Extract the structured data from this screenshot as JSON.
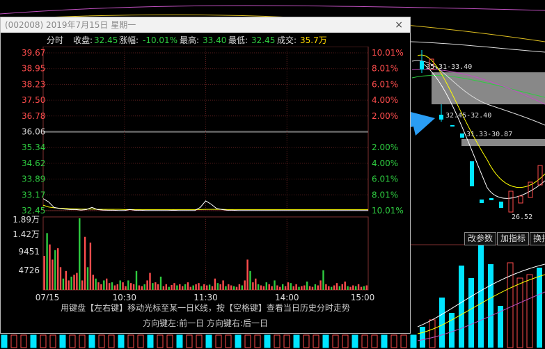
{
  "dialog": {
    "title": "(002008) 2019年7月15日 星期一",
    "close_label": "×",
    "info": {
      "mode_label": "分时",
      "close_label": "收盘:",
      "close_value": "32.45",
      "change_label": "涨幅:",
      "change_value": "-10.01%",
      "high_label": "最高:",
      "high_value": "33.40",
      "low_label": "最低:",
      "low_value": "32.45",
      "volume_label": "成交:",
      "volume_value": "35.7万"
    },
    "hint_line1": "用键盘【左右键】移动光标至某一日K线，按【空格键】查看当日历史分时走势",
    "hint_line2": "方向键左:前一日    方向键右:后一日"
  },
  "chart_data": {
    "type": "line",
    "y_left_ticks": [
      "39.67",
      "38.95",
      "38.23",
      "37.50",
      "36.78",
      "36.06",
      "35.34",
      "34.62",
      "33.89",
      "33.17",
      "32.45"
    ],
    "y_right_ticks": [
      "10.01%",
      "8.01%",
      "6.01%",
      "4.00%",
      "2.00%",
      "",
      "2.00%",
      "4.00%",
      "6.01%",
      "8.01%",
      "10.01%"
    ],
    "ylim": [
      32.45,
      39.67
    ],
    "prev_close": 36.06,
    "volume_ticks": [
      "1.89万",
      "1.42万",
      "9451",
      "4726"
    ],
    "volume_max": 18900,
    "x_ticks": [
      "07/15",
      "10:30",
      "11:30",
      "14:00",
      "15:00"
    ],
    "price_series": [
      33.0,
      32.85,
      32.6,
      32.55,
      32.52,
      32.5,
      32.5,
      32.48,
      32.5,
      32.6,
      32.5,
      32.48,
      32.47,
      32.47,
      32.46,
      32.46,
      32.5,
      32.47,
      32.47,
      32.46,
      32.46,
      32.46,
      32.46,
      32.46,
      32.47,
      32.46,
      32.46,
      32.46,
      32.46,
      32.6,
      32.9,
      32.75,
      32.55,
      32.5,
      32.47,
      32.47,
      32.46,
      32.46,
      32.46,
      32.46,
      32.46,
      32.46,
      32.46,
      32.46,
      32.46,
      32.46,
      32.46,
      32.46,
      32.46,
      32.46,
      32.46,
      32.46,
      32.46,
      32.46,
      32.46,
      32.46,
      32.46,
      32.46,
      32.46,
      32.46,
      32.46
    ],
    "avg_series": [
      32.7,
      32.62,
      32.58,
      32.56,
      32.55,
      32.54,
      32.53,
      32.52,
      32.52,
      32.52,
      32.51,
      32.51,
      32.51,
      32.51,
      32.51,
      32.5,
      32.5,
      32.5,
      32.5,
      32.5,
      32.5,
      32.5,
      32.5,
      32.5,
      32.5,
      32.5,
      32.5,
      32.5,
      32.5,
      32.5,
      32.51,
      32.51,
      32.51,
      32.51,
      32.5,
      32.5,
      32.5,
      32.5,
      32.5,
      32.5,
      32.5,
      32.5,
      32.5,
      32.5,
      32.5,
      32.5,
      32.5,
      32.5,
      32.5,
      32.5,
      32.5,
      32.5,
      32.5,
      32.5,
      32.5,
      32.5,
      32.5,
      32.5,
      32.5,
      32.5,
      32.5
    ],
    "volume_bars": [
      9000,
      15000,
      12000,
      8000,
      10500,
      11000,
      6000,
      3000,
      5000,
      2500,
      3500,
      4000,
      4500,
      18900,
      2500,
      14000,
      6000,
      12500,
      4000,
      3000,
      2000,
      1500,
      2500,
      3000,
      1800,
      2000,
      1200,
      1500,
      2500,
      2000,
      1000,
      2500,
      1800,
      1500,
      5000,
      1200,
      1000,
      1500,
      2500,
      4500,
      1800,
      2000,
      1500,
      3500,
      1000,
      1500,
      800,
      1300,
      1800,
      1200,
      1500,
      1000,
      1500,
      2000,
      800,
      1200,
      1500,
      1800,
      1000,
      1500,
      1200,
      1400,
      1000,
      3000,
      1800,
      1500,
      2500,
      1000,
      1500,
      1200,
      1000,
      800,
      1500,
      1200,
      2500,
      8000,
      5000,
      2000,
      3000,
      1500,
      1200,
      1000,
      2000,
      1500,
      1000,
      2500,
      1200,
      800,
      1500,
      1000,
      2000,
      1800,
      1000,
      1500,
      800,
      1000,
      1200,
      2200,
      1000,
      800,
      1500,
      1200,
      2500,
      5200,
      1500,
      1000,
      800,
      1200,
      1800,
      1000,
      1500,
      2200,
      1000,
      800,
      1200,
      1000,
      1500,
      800,
      1000,
      1200
    ],
    "volume_colors_up": [
      true,
      false,
      true,
      false,
      true,
      false,
      true,
      false,
      true,
      false
    ]
  },
  "background": {
    "kline_annotations": [
      "35.31-33.40",
      "32.45-32.40",
      "31.33-30.87",
      "26.52"
    ],
    "buttons": [
      "改参数",
      "加指标",
      "换指"
    ]
  },
  "colors": {
    "price_line": "#ffffff",
    "avg_line": "#ffff00",
    "up_red": "#ff4d4d",
    "down_green": "#2ecc40",
    "cyan": "#00e5ff",
    "arrow": "#2a9df4"
  }
}
